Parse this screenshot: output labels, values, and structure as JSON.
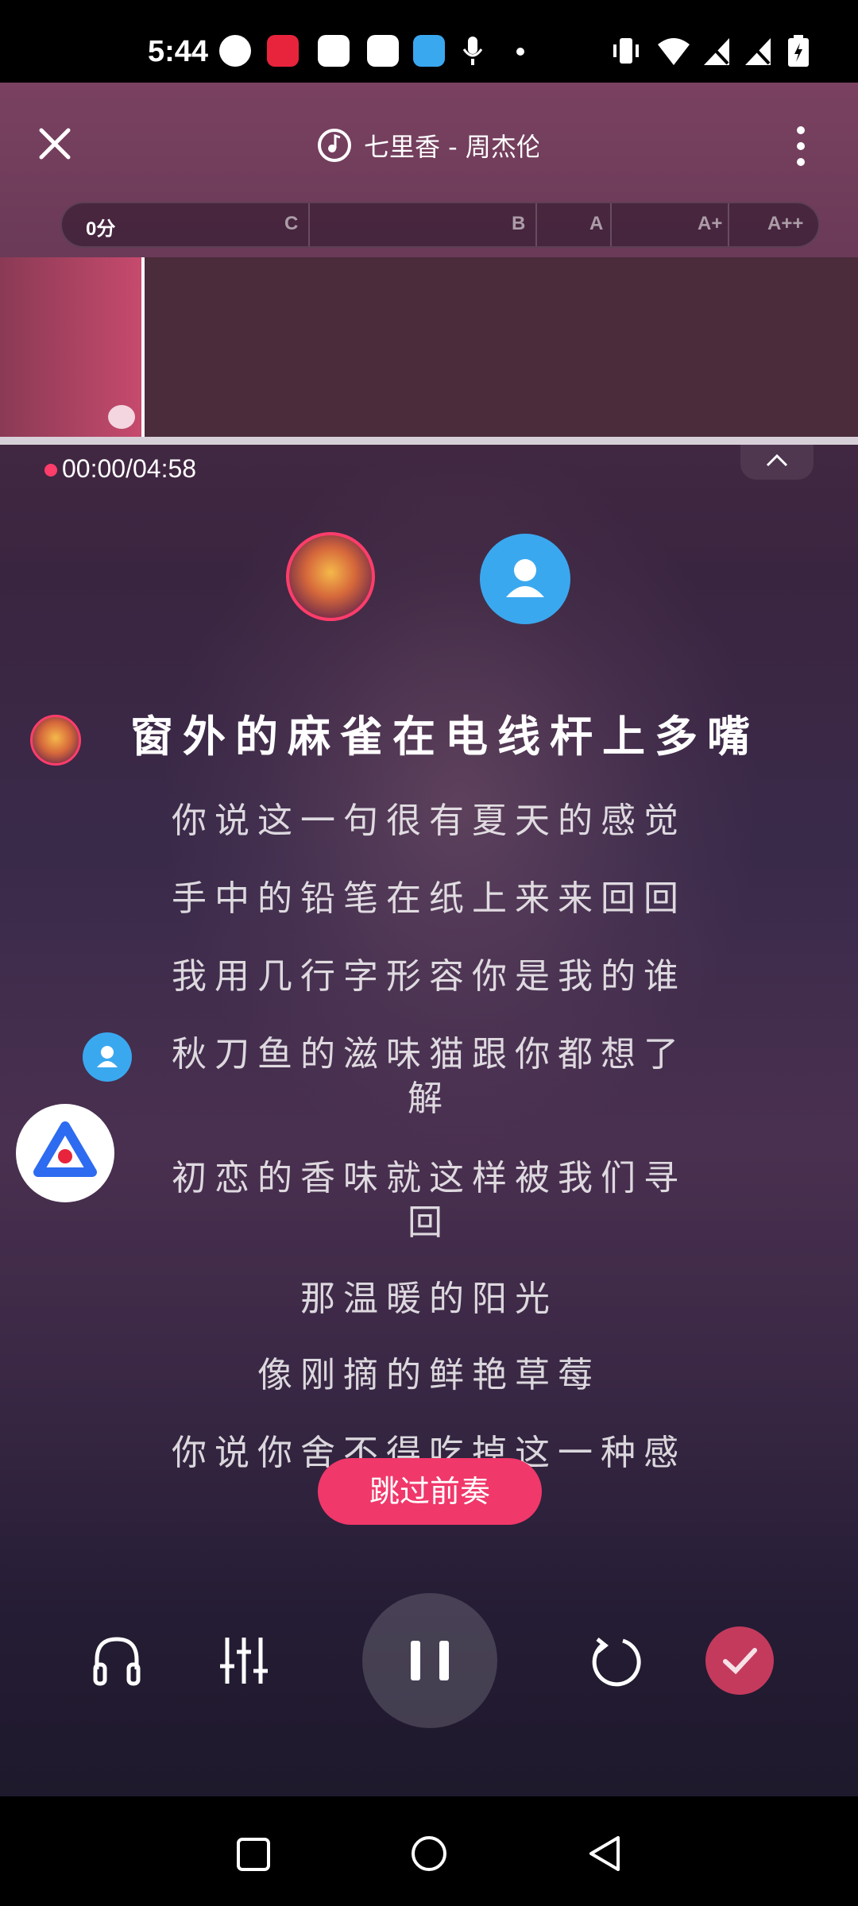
{
  "status_bar": {
    "time": "5:44",
    "icons": [
      "app-icon-p",
      "app-icon-xiaohongshu",
      "app-icon-star",
      "app-icon-0",
      "app-icon-cloud",
      "mic-icon",
      "dot-icon"
    ],
    "right_icons": [
      "vibrate-icon",
      "wifi-icon",
      "no-signal-icon",
      "no-signal-icon",
      "battery-icon"
    ]
  },
  "header": {
    "song_title": "七里香 - 周杰伦",
    "score_labels": [
      "0分",
      "C",
      "B",
      "A",
      "A+",
      "A++"
    ]
  },
  "player": {
    "time": "00:00/04:58",
    "skip_intro": "跳过前奏"
  },
  "lyrics": {
    "active": "窗外的麻雀在电线杆上多嘴",
    "lines": [
      "你说这一句很有夏天的感觉",
      "手中的铅笔在纸上来来回回",
      "我用几行字形容你是我的谁",
      "秋刀鱼的滋味猫跟你都想了",
      "解",
      "初恋的香味就这样被我们寻",
      "回",
      "那温暖的阳光",
      "像刚摘的鲜艳草莓",
      "你说你舍不得吃掉这一种感"
    ]
  },
  "controls": [
    "headphones-icon",
    "equalizer-icon",
    "pause-icon",
    "restart-icon",
    "confirm-icon"
  ],
  "colors": {
    "accent": "#f0386a",
    "confirm": "#c43a5d",
    "avatar_blue": "#3aa8ef"
  }
}
